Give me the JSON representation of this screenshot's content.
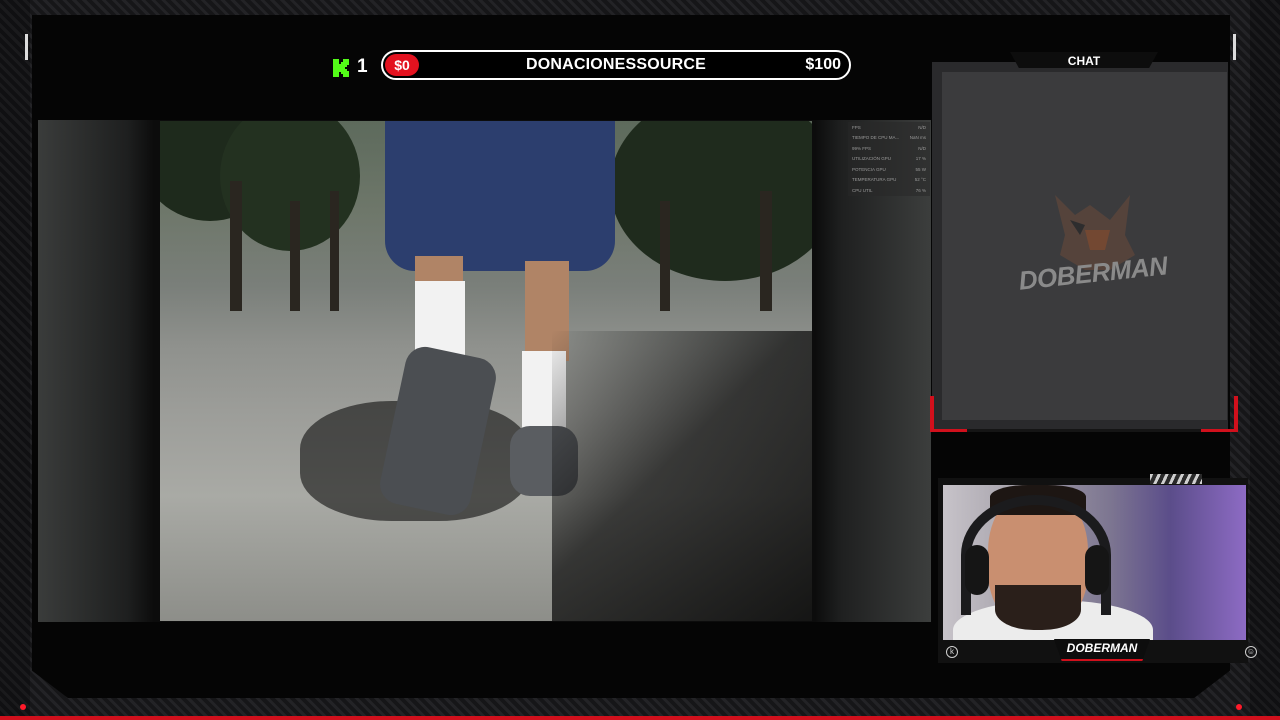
{
  "colors": {
    "accent_red": "#d1101c",
    "kick_green": "#53fc18",
    "background": "#050505"
  },
  "donation_bar": {
    "kick_count": "1",
    "current_amount": "$0",
    "title": "DONACIONESSOURCE",
    "goal_amount": "$100"
  },
  "stats_overlay": {
    "rows": [
      {
        "label": "FPS",
        "value": "N/D"
      },
      {
        "label": "TIEMPO DE CPU MA...",
        "value": "NaN ms"
      },
      {
        "label": "99% FPS",
        "value": "N/D"
      },
      {
        "label": "UTILIZACIÓN GPU",
        "value": "17 %"
      },
      {
        "label": "POTENCIA GPU",
        "value": "55 W"
      },
      {
        "label": "TEMPERATURA GPU",
        "value": "52 °C"
      },
      {
        "label": "CPU UTIL",
        "value": "76 %"
      }
    ]
  },
  "chat": {
    "title": "CHAT",
    "watermark": "DOBERMAN"
  },
  "webcam": {
    "name": "DOBERMAN",
    "icon_left": "kick-circle-icon",
    "icon_right": "account-circle-icon"
  }
}
